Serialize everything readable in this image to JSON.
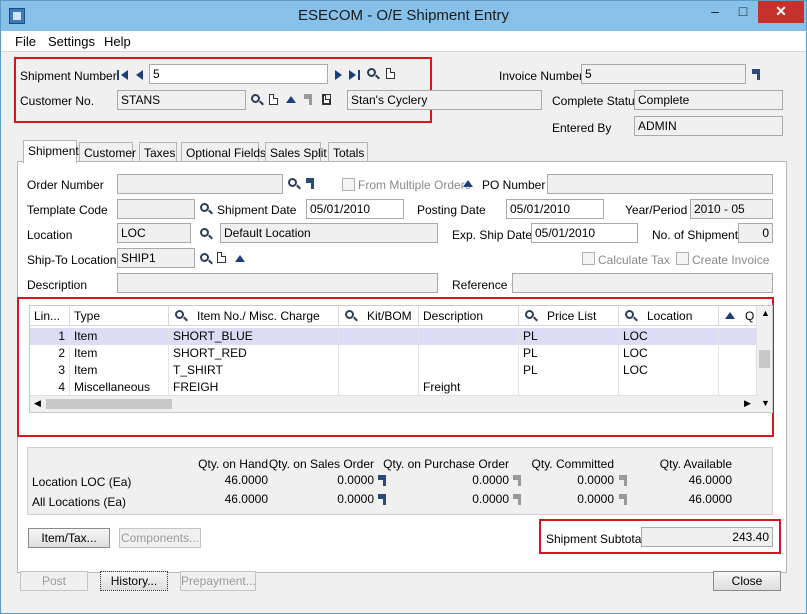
{
  "window": {
    "title": "ESECOM - O/E Shipment Entry",
    "minimize": "–",
    "maximize": "□",
    "close": "✕"
  },
  "menu": {
    "file": "File",
    "settings": "Settings",
    "help": "Help"
  },
  "header": {
    "shipment_number_label": "Shipment Number",
    "shipment_number": "5",
    "customer_no_label": "Customer No.",
    "customer_no": "STANS",
    "customer_name": "Stan's Cyclery",
    "invoice_number_label": "Invoice Number",
    "invoice_number": "5",
    "complete_status_label": "Complete Status",
    "complete_status": "Complete",
    "entered_by_label": "Entered By",
    "entered_by": "ADMIN"
  },
  "tabs": [
    "Shipment",
    "Customer",
    "Taxes",
    "Optional Fields",
    "Sales Split",
    "Totals"
  ],
  "shipment": {
    "order_number_label": "Order Number",
    "order_number": "",
    "from_multiple_orders_label": "From Multiple Orders",
    "po_number_label": "PO Number",
    "po_number": "",
    "template_code_label": "Template Code",
    "template_code": "",
    "shipment_date_label": "Shipment Date",
    "shipment_date": "05/01/2010",
    "posting_date_label": "Posting Date",
    "posting_date": "05/01/2010",
    "year_period_label": "Year/Period",
    "year_period": "2010 - 05",
    "location_label": "Location",
    "location": "LOC",
    "location_desc": "Default Location",
    "exp_ship_date_label": "Exp. Ship Date",
    "exp_ship_date": "05/01/2010",
    "no_of_shipments_label": "No. of Shipments",
    "no_of_shipments": "0",
    "ship_to_location_label": "Ship-To Location",
    "ship_to_location": "SHIP1",
    "calculate_tax_label": "Calculate Tax",
    "create_invoice_label": "Create Invoice",
    "description_label": "Description",
    "description": "",
    "reference_label": "Reference",
    "reference": ""
  },
  "grid": {
    "columns": [
      "Lin...",
      "Type",
      "Item No./ Misc. Charge",
      "Kit/BOM",
      "Description",
      "Price List",
      "Location",
      "Q"
    ],
    "rows": [
      {
        "line": "1",
        "type": "Item",
        "item": "SHORT_BLUE",
        "kit": "",
        "description": "",
        "price_list": "PL",
        "location": "LOC"
      },
      {
        "line": "2",
        "type": "Item",
        "item": "SHORT_RED",
        "kit": "",
        "description": "",
        "price_list": "PL",
        "location": "LOC"
      },
      {
        "line": "3",
        "type": "Item",
        "item": "T_SHIRT",
        "kit": "",
        "description": "",
        "price_list": "PL",
        "location": "LOC"
      },
      {
        "line": "4",
        "type": "Miscellaneous",
        "item": "FREIGH",
        "kit": "",
        "description": "Freight",
        "price_list": "",
        "location": ""
      }
    ]
  },
  "summary": {
    "headers": [
      "Qty. on Hand",
      "Qty. on Sales Order",
      "Qty. on Purchase Order",
      "Qty. Committed",
      "Qty. Available"
    ],
    "rows": [
      {
        "label": "Location  LOC (Ea)",
        "on_hand": "46.0000",
        "on_sales_order": "0.0000",
        "on_purchase_order": "0.0000",
        "committed": "0.0000",
        "available": "46.0000"
      },
      {
        "label": "All Locations (Ea)",
        "on_hand": "46.0000",
        "on_sales_order": "0.0000",
        "on_purchase_order": "0.0000",
        "committed": "0.0000",
        "available": "46.0000"
      }
    ]
  },
  "buttons": {
    "item_tax": "Item/Tax...",
    "components": "Components...",
    "post": "Post",
    "history": "History...",
    "prepayment": "Prepayment...",
    "close": "Close"
  },
  "subtotal": {
    "label": "Shipment Subtotal",
    "value": "243.40"
  },
  "colors": {
    "highlight_box": "#d9161f",
    "titlebar": "#87c0e8",
    "selected_row": "#dcdcf5"
  }
}
